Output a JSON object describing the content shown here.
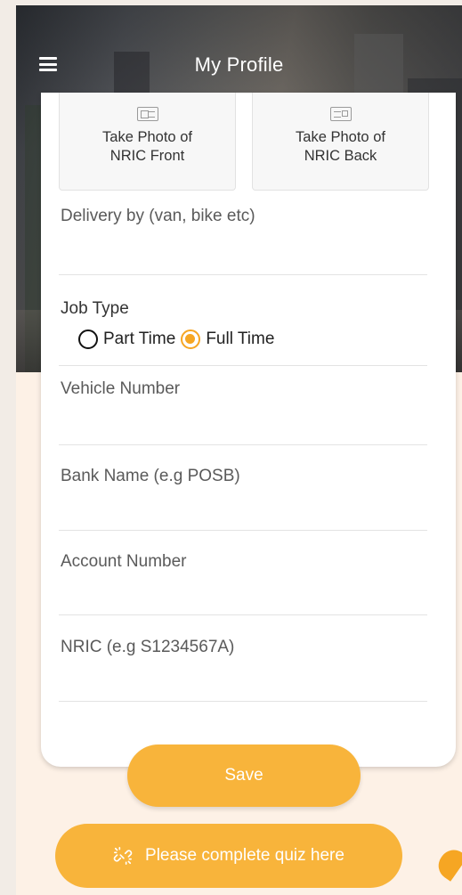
{
  "header": {
    "title": "My Profile"
  },
  "photo_buttons": {
    "front_label": "Take Photo of\nNRIC Front",
    "back_label": "Take Photo of\nNRIC Back"
  },
  "fields": {
    "delivery_placeholder": "Delivery by (van, bike etc)",
    "vehicle_placeholder": "Vehicle Number",
    "bank_placeholder": "Bank Name (e.g POSB)",
    "account_placeholder": "Account Number",
    "nric_placeholder": "NRIC (e.g S1234567A)"
  },
  "job_type": {
    "label": "Job Type",
    "options": [
      "Part Time",
      "Full Time"
    ],
    "selected": "Full Time"
  },
  "actions": {
    "save_label": "Save",
    "quiz_label": "Please complete quiz here"
  },
  "icons": {
    "menu": "hamburger-menu-icon",
    "front": "id-card-front-icon",
    "back": "id-card-back-icon",
    "quiz": "broken-link-icon"
  },
  "colors": {
    "accent": "#f8b43b",
    "radio_selected": "#f6a623"
  }
}
